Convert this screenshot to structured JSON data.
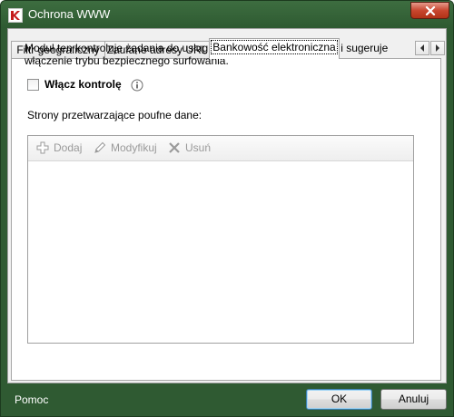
{
  "window": {
    "title": "Ochrona WWW",
    "icon": "kaspersky-k-icon",
    "close_icon": "close-x-icon"
  },
  "tabs": [
    {
      "label": "Filtr geograficzny",
      "active": false
    },
    {
      "label": "Zaufane adresy URL",
      "active": false
    },
    {
      "label": "Bankowość elektroniczna",
      "active": true
    }
  ],
  "tab_scroll": {
    "left_icon": "arrow-left-icon",
    "right_icon": "arrow-right-icon"
  },
  "panel": {
    "description": "Moduł ten kontroluje żądania do usług bankowości elektronicznej i sugeruje włączenie trybu bezpiecznego surfowania.",
    "checkbox_label": "Włącz kontrolę",
    "checkbox_checked": false,
    "info_icon": "info-icon",
    "list_label": "Strony przetwarzające poufne dane:"
  },
  "toolbar": {
    "add_label": "Dodaj",
    "edit_label": "Modyfikuj",
    "delete_label": "Usuń"
  },
  "footer": {
    "help_label": "Pomoc",
    "ok_label": "OK",
    "cancel_label": "Anuluj"
  },
  "colors": {
    "frame": "#2f5a32",
    "close_button": "#c8472f",
    "disabled_text": "#9a9a9a"
  }
}
